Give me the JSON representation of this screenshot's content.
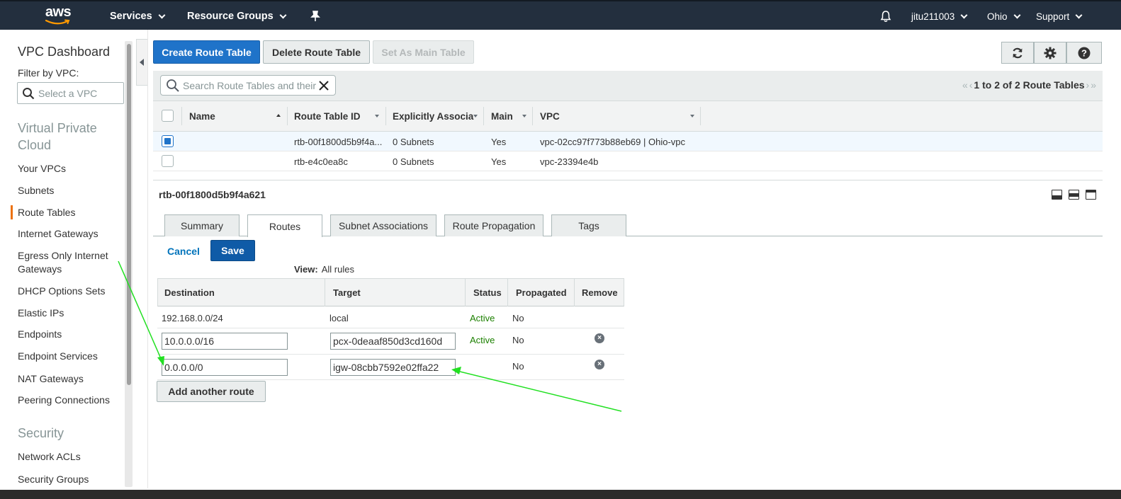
{
  "topnav": {
    "logo": "aws",
    "services": "Services",
    "resource_groups": "Resource Groups",
    "pin_icon": "pushpin-icon",
    "bell_icon": "bell-icon",
    "account": "jitu211003",
    "region": "Ohio",
    "support": "Support"
  },
  "sidebar": {
    "title": "VPC Dashboard",
    "filter_label": "Filter by VPC:",
    "filter_placeholder": "Select a VPC",
    "section_vpc": "Virtual Private Cloud",
    "items": [
      {
        "label": "Your VPCs"
      },
      {
        "label": "Subnets"
      },
      {
        "label": "Route Tables",
        "active": true
      },
      {
        "label": "Internet Gateways"
      },
      {
        "label": "Egress Only Internet Gateways"
      },
      {
        "label": "DHCP Options Sets"
      },
      {
        "label": "Elastic IPs"
      },
      {
        "label": "Endpoints"
      },
      {
        "label": "Endpoint Services"
      },
      {
        "label": "NAT Gateways"
      },
      {
        "label": "Peering Connections"
      }
    ],
    "section_security": "Security",
    "security_items": [
      {
        "label": "Network ACLs"
      },
      {
        "label": "Security Groups"
      }
    ]
  },
  "toolbar": {
    "create": "Create Route Table",
    "delete": "Delete Route Table",
    "set_main": "Set As Main Table",
    "icons": [
      "refresh-icon",
      "gear-icon",
      "help-icon"
    ]
  },
  "search": {
    "placeholder": "Search Route Tables and their"
  },
  "pager": {
    "text": "1 to 2 of 2 Route Tables"
  },
  "route_tables": {
    "columns": [
      "Name",
      "Route Table ID",
      "Explicitly Associa",
      "Main",
      "VPC"
    ],
    "rows": [
      {
        "name": "",
        "id": "rtb-00f1800d5b9f4a...",
        "assoc": "0 Subnets",
        "main": "Yes",
        "vpc": "vpc-02cc97f773b88eb69 | Ohio-vpc",
        "selected": true
      },
      {
        "name": "",
        "id": "rtb-e4c0ea8c",
        "assoc": "0 Subnets",
        "main": "Yes",
        "vpc": "vpc-23394e4b",
        "selected": false
      }
    ]
  },
  "detail": {
    "title": "rtb-00f1800d5b9f4a621",
    "tabs": [
      "Summary",
      "Routes",
      "Subnet Associations",
      "Route Propagation",
      "Tags"
    ],
    "active_tab": "Routes",
    "cancel": "Cancel",
    "save": "Save",
    "view_label": "View:",
    "view_value": "All rules",
    "routes_columns": [
      "Destination",
      "Target",
      "Status",
      "Propagated",
      "Remove"
    ],
    "routes": [
      {
        "destination": "192.168.0.0/24",
        "target": "local",
        "status": "Active",
        "propagated": "No",
        "editable": false
      },
      {
        "destination": "10.0.0.0/16",
        "target": "pcx-0deaaf850d3cd160d",
        "status": "Active",
        "propagated": "No",
        "editable": true
      },
      {
        "destination": "0.0.0.0/0",
        "target": "igw-08cbb7592e02ffa22",
        "status": "",
        "propagated": "No",
        "editable": true
      }
    ],
    "add_route": "Add another route"
  },
  "colors": {
    "nav_bg": "#232f3e",
    "primary": "#1f73c9",
    "active_status": "#1d8102",
    "sidebar_active": "#ec7211",
    "annotation_arrow": "#22e022"
  }
}
